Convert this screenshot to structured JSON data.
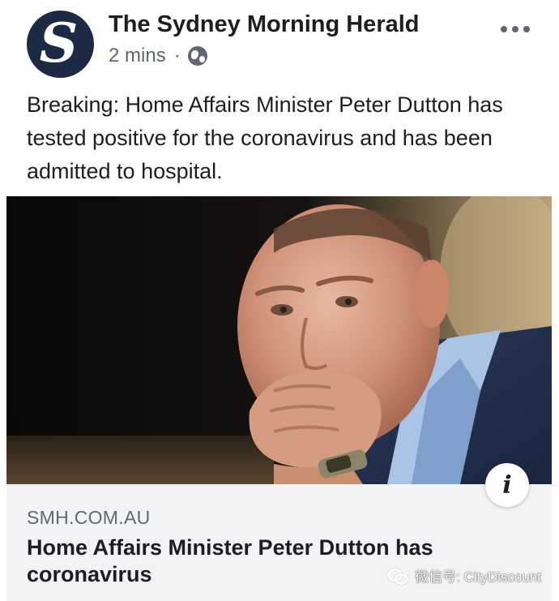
{
  "post": {
    "page_name": "The Sydney Morning Herald",
    "avatar_letter": "S",
    "timestamp": "2 mins",
    "separator": "·",
    "privacy_icon": "globe-icon",
    "more_icon": "more-options-icon",
    "text": "Breaking: Home Affairs Minister Peter Dutton has tested positive for the coronavirus and has been admitted to hospital."
  },
  "link": {
    "image_icon": "info-icon",
    "info_label": "i",
    "domain": "SMH.COM.AU",
    "title": "Home Affairs Minister Peter Dutton has coronavirus"
  },
  "watermark": {
    "icon": "wechat-icon",
    "text": "微信号: CityDiscount"
  },
  "colors": {
    "avatar_bg": "#1c2a44",
    "text_primary": "#1c1e21",
    "text_secondary": "#606770",
    "caption_bg": "#f2f3f5"
  }
}
